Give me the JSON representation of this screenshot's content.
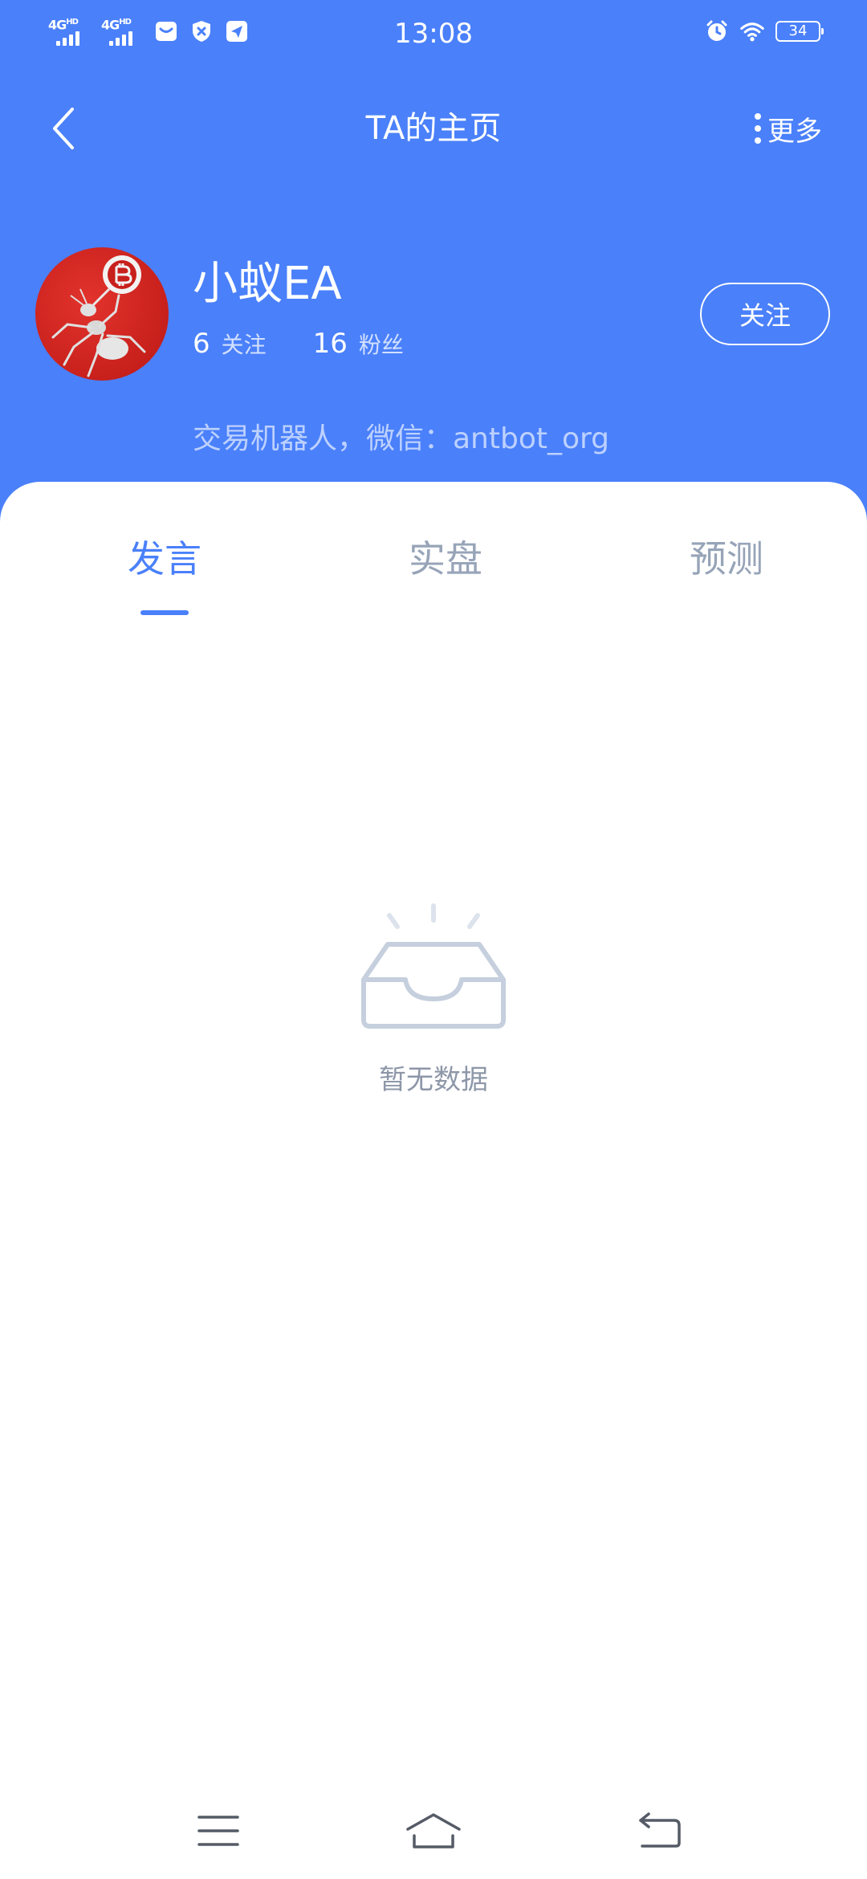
{
  "status_bar": {
    "net1": "4G",
    "net1_sup": "HD",
    "net2": "4G",
    "net2_sup": "HD",
    "time": "13:08",
    "battery": "34"
  },
  "nav": {
    "title": "TA的主页",
    "more_label": "更多"
  },
  "profile": {
    "username": "小蚁EA",
    "following_count": "6",
    "following_label": "关注",
    "followers_count": "16",
    "followers_label": "粉丝",
    "follow_button": "关注",
    "bio": "交易机器人，微信：antbot_org"
  },
  "tabs": [
    {
      "label": "发言",
      "active": true
    },
    {
      "label": "实盘",
      "active": false
    },
    {
      "label": "预测",
      "active": false
    }
  ],
  "empty_state": {
    "text": "暂无数据"
  },
  "colors": {
    "primary": "#4a80fa",
    "tab_inactive": "#97a4b8",
    "empty_text": "#8d97a8"
  }
}
